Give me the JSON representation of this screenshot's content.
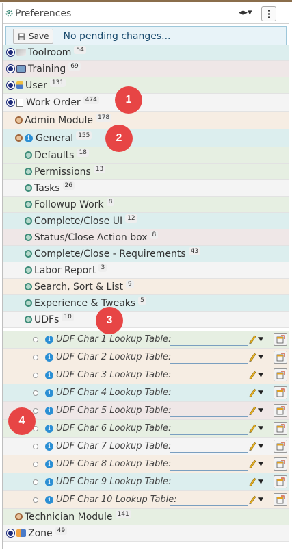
{
  "header": {
    "title": "Preferences",
    "toggle_glyph": "◂▸▾"
  },
  "savebar": {
    "save_label": "Save",
    "status": "No pending changes..."
  },
  "top_items": [
    {
      "label": "Toolroom",
      "count": "54"
    },
    {
      "label": "Training",
      "count": "69"
    },
    {
      "label": "User",
      "count": "131"
    },
    {
      "label": "Work Order",
      "count": "474"
    }
  ],
  "admin_module": {
    "label": "Admin Module",
    "count": "178"
  },
  "general": {
    "label": "General",
    "count": "155"
  },
  "general_children": [
    {
      "label": "Defaults",
      "count": "18"
    },
    {
      "label": "Permissions",
      "count": "13"
    },
    {
      "label": "Tasks",
      "count": "26"
    },
    {
      "label": "Followup Work",
      "count": "8"
    },
    {
      "label": "Complete/Close UI",
      "count": "12"
    },
    {
      "label": "Status/Close Action box",
      "count": "8"
    },
    {
      "label": "Complete/Close - Requirements",
      "count": "43"
    },
    {
      "label": "Labor Report",
      "count": "3"
    },
    {
      "label": "Search, Sort & List",
      "count": "9"
    },
    {
      "label": "Experience & Tweaks",
      "count": "5"
    },
    {
      "label": "UDFs",
      "count": "10"
    }
  ],
  "udfs": [
    "UDF Char 1 Lookup Table:",
    "UDF Char 2 Lookup Table:",
    "UDF Char 3 Lookup Table:",
    "UDF Char 4 Lookup Table:",
    "UDF Char 5 Lookup Table:",
    "UDF Char 6 Lookup Table:",
    "UDF Char 7 Lookup Table:",
    "UDF Char 8 Lookup Table:",
    "UDF Char 9 Lookup Table:",
    "UDF Char 10 Lookup Table:"
  ],
  "technician_module": {
    "label": "Technician Module",
    "count": "141"
  },
  "zone": {
    "label": "Zone",
    "count": "49"
  },
  "markers": [
    "1",
    "2",
    "3",
    "4"
  ],
  "colors": {
    "navy_bullet": "#1d2b7a",
    "info_blue": "#2b8fd4",
    "marker_red": "#e74545",
    "row_teal": "#dceeee",
    "row_tan": "#f3ece2",
    "row_green": "#e6efe2",
    "row_pink": "#efe5e5"
  },
  "icons": {
    "gear": "gear-icon",
    "kebab": "kebab-menu-icon",
    "save": "floppy-disk-icon",
    "info": "info-icon",
    "pencil": "pencil-icon",
    "lookup": "lookup-table-icon"
  }
}
